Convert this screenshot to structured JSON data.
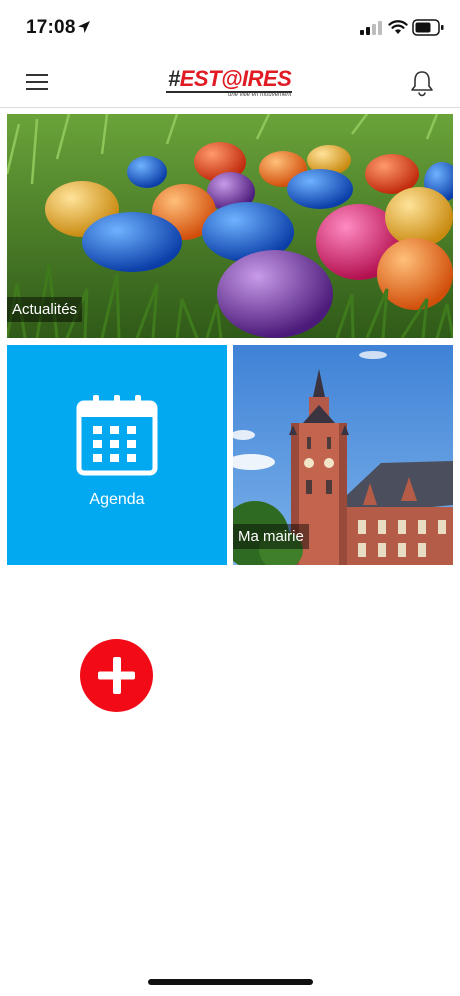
{
  "status_bar": {
    "time": "17:08",
    "icons": [
      "location-arrow-icon",
      "signal-icon",
      "wifi-icon",
      "battery-icon"
    ]
  },
  "header": {
    "logo_hash": "#",
    "logo_text": "EST@IRES",
    "logo_tagline": "une ville en mouvement",
    "menu_icon": "hamburger-menu-icon",
    "notification_icon": "bell-icon"
  },
  "tiles": {
    "news": {
      "label": "Actualités"
    },
    "agenda": {
      "label": "Agenda",
      "icon": "calendar-icon"
    },
    "mairie": {
      "label": "Ma mairie"
    }
  },
  "add_button": {
    "icon": "plus-icon"
  },
  "colors": {
    "agenda_bg": "#03a9f0",
    "add_button_bg": "#f20b16",
    "logo_red": "#e01b24"
  }
}
